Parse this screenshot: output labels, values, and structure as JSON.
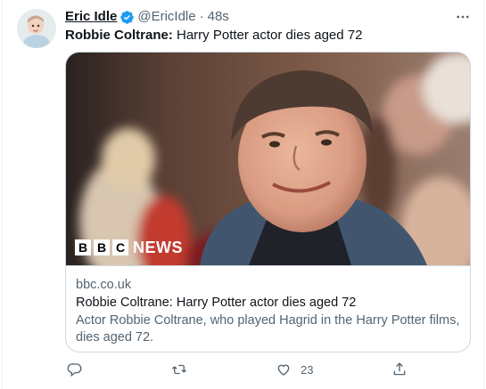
{
  "author": {
    "display_name": "Eric Idle",
    "handle": "@EricIdle",
    "separator": "·",
    "time": "48s"
  },
  "tweet": {
    "text_bold": "Robbie Coltrane:",
    "text_rest": " Harry Potter actor dies aged 72"
  },
  "card": {
    "image_logo": "BBC NEWS",
    "image_logo_blocks": [
      "B",
      "B",
      "C"
    ],
    "image_logo_word": "NEWS",
    "domain": "bbc.co.uk",
    "title": "Robbie Coltrane: Harry Potter actor dies aged 72",
    "description": "Actor Robbie Coltrane, who played Hagrid in the Harry Potter films, dies aged 72."
  },
  "actions": {
    "reply_icon": "reply-icon",
    "retweet_icon": "retweet-icon",
    "like_icon": "heart-icon",
    "like_count": "23",
    "share_icon": "share-icon"
  },
  "colors": {
    "text": "#0f1419",
    "secondary": "#536471",
    "border": "#cfd9de",
    "verified": "#1d9bf0"
  }
}
